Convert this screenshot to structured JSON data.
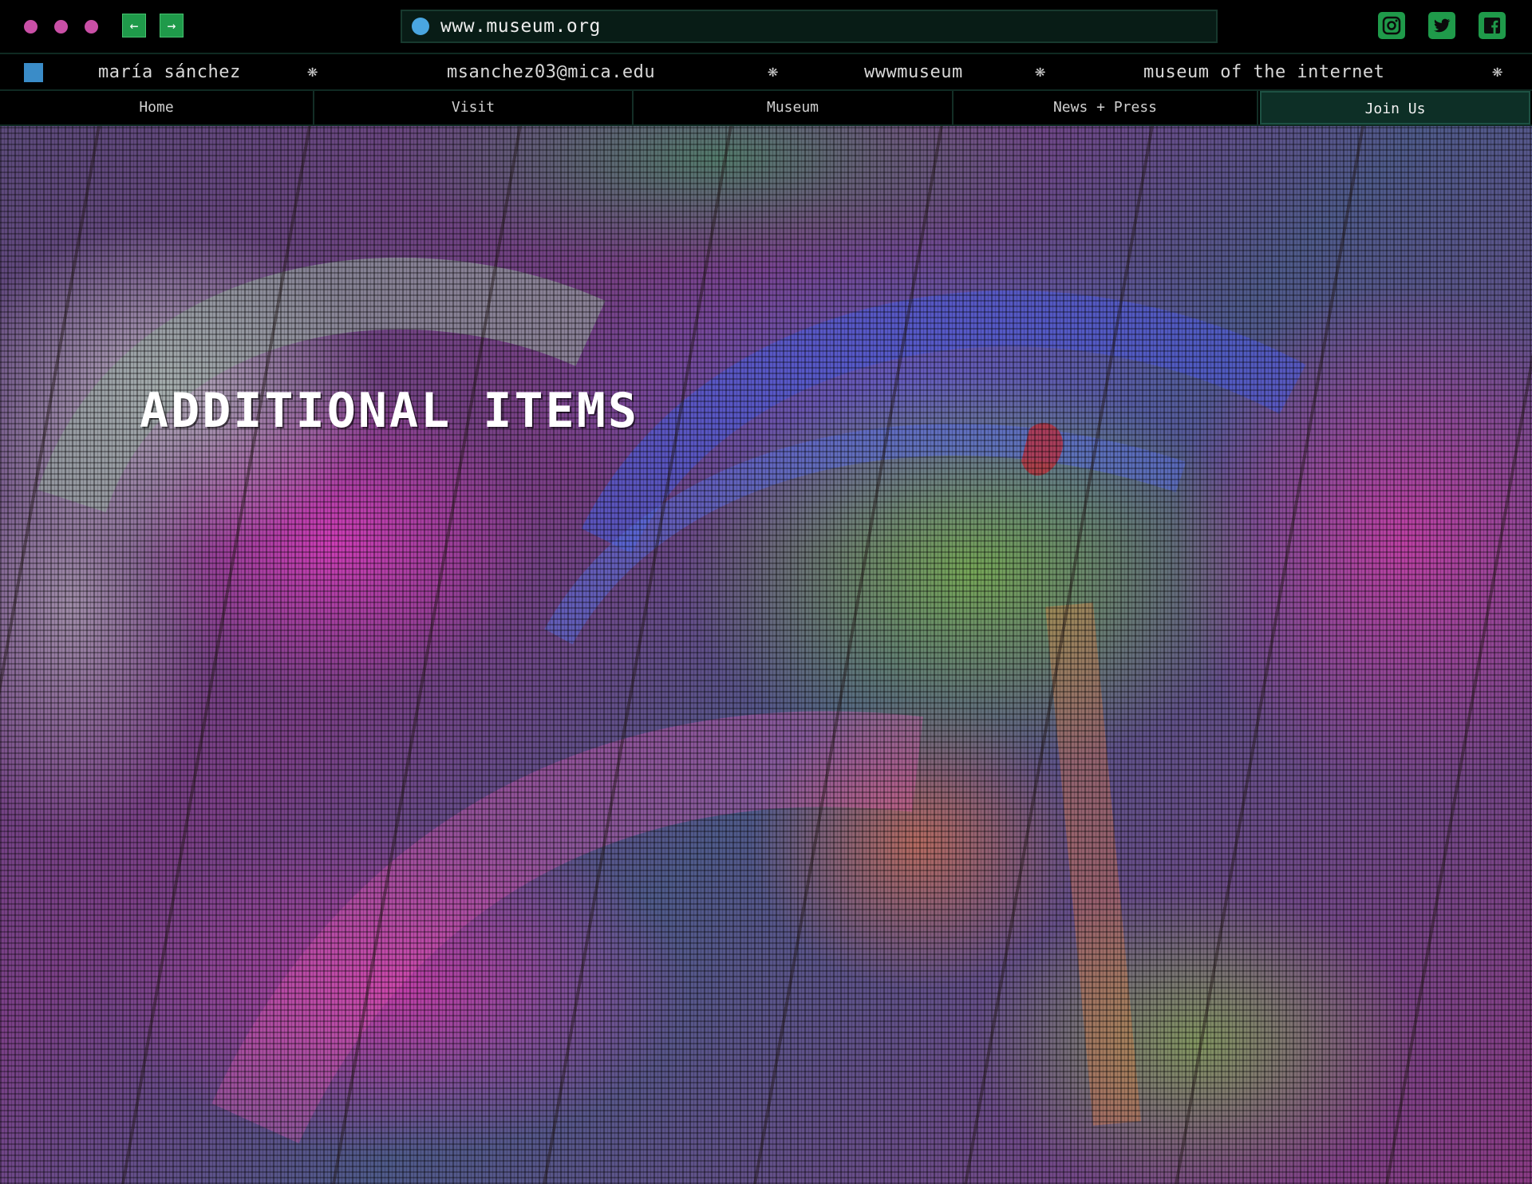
{
  "browser": {
    "url": "www.museum.org",
    "back_label": "←",
    "forward_label": "→",
    "social": [
      "instagram-icon",
      "twitter-icon",
      "facebook-icon"
    ]
  },
  "info_strip": {
    "name": "maría sánchez",
    "email": "msanchez03@mica.edu",
    "handle": "wwwmuseum",
    "tagline": "museum of the internet",
    "separator": "❋"
  },
  "nav": {
    "items": [
      {
        "label": "Home"
      },
      {
        "label": "Visit"
      },
      {
        "label": "Museum"
      },
      {
        "label": "News + Press"
      },
      {
        "label": "Join Us"
      }
    ],
    "active": "Join Us"
  },
  "hero": {
    "title": "ADDITIONAL ITEMS"
  },
  "colors": {
    "accent_green": "#1f9a4a",
    "window_dot": "#c94fa6",
    "url_dot": "#4aa6e0",
    "info_square": "#3a8cc8",
    "nav_active_bg": "#0d2f26"
  }
}
